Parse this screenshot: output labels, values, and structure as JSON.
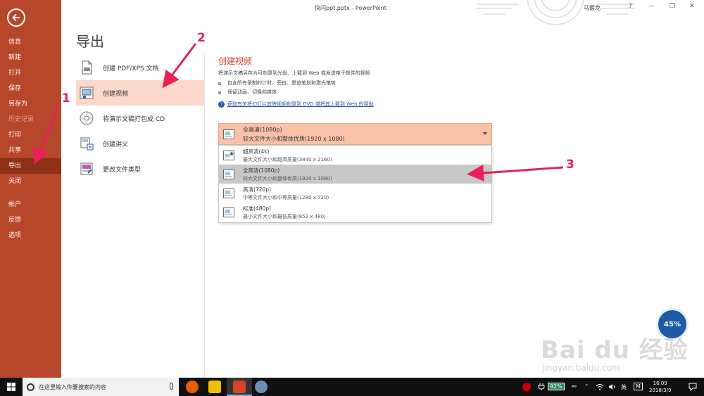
{
  "window": {
    "title": "快闪ppt.pptx - PowerPoint",
    "user": "马霰龙",
    "help": "?",
    "minimize": "—",
    "restore": "❐",
    "close": "✕"
  },
  "sidebar": {
    "items": [
      {
        "label": "信息"
      },
      {
        "label": "新建"
      },
      {
        "label": "打开"
      },
      {
        "label": "保存"
      },
      {
        "label": "另存为"
      },
      {
        "label": "历史记录"
      },
      {
        "label": "打印"
      },
      {
        "label": "共享"
      },
      {
        "label": "导出"
      },
      {
        "label": "关闭"
      },
      {
        "label": "帐户"
      },
      {
        "label": "反馈"
      },
      {
        "label": "选项"
      }
    ]
  },
  "page": {
    "title": "导出"
  },
  "export_options": [
    {
      "label": "创建 PDF/XPS 文档"
    },
    {
      "label": "创建视频"
    },
    {
      "label": "将演示文稿打包成 CD"
    },
    {
      "label": "创建讲义"
    },
    {
      "label": "更改文件类型"
    }
  ],
  "video": {
    "title": "创建视频",
    "description": "将演示文稿另存为可刻录到光盘、上载到 Web 或发送电子邮件的视频",
    "bullets": [
      "包含所有录制的计时、旁白、墨迹笔划和激光笔势",
      "保留动画、切换和媒体"
    ],
    "help_link": "获取有关将幻灯片放映视频刻录到 DVD 或将其上载到 Web 的帮助",
    "help_icon": "?"
  },
  "quality": {
    "selected_title": "全高清(1080p)",
    "selected_sub": "较大文件大小和整体优质(1920 x 1080)",
    "options": [
      {
        "title": "超高清(4k)",
        "sub": "最大文件大小和超高质量(3840 x 2160)"
      },
      {
        "title": "全高清(1080p)",
        "sub": "较大文件大小和整体优质(1920 x 1080)"
      },
      {
        "title": "高清(720p)",
        "sub": "中等文件大小和中等质量(1280 x 720)"
      },
      {
        "title": "标准(480p)",
        "sub": "最小文件大小和最低质量(852 x 480)"
      }
    ]
  },
  "annotations": {
    "n1": "1",
    "n2": "2",
    "n3": "3",
    "color": "#e8205a"
  },
  "badge": {
    "value": "45%"
  },
  "watermark": {
    "brand": "Bai du 经验",
    "url": "jingyan.baidu.com"
  },
  "taskbar": {
    "search_placeholder": "在这里输入你要搜索的内容",
    "battery": "92%",
    "ime": "英",
    "ime_mode": "M",
    "time": "16:09",
    "date": "2018/3/9"
  },
  "colors": {
    "sidebar": "#b7472a",
    "accent": "#d04423",
    "selected_option": "#fcd9cb",
    "dropdown": "#f9c2a9"
  }
}
